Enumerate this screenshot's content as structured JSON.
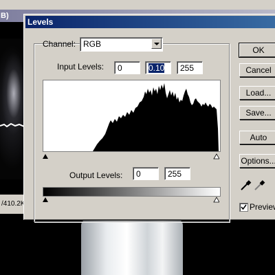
{
  "background": {
    "title_fragment": "B)",
    "status_text": "/410.2K"
  },
  "dialog": {
    "title": "Levels",
    "channel_label": "Channel:",
    "channel_value": "RGB",
    "input_levels_label": "Input Levels:",
    "input_black": "0",
    "input_gamma": "0.10",
    "input_white": "255",
    "output_levels_label": "Output Levels:",
    "output_black": "0",
    "output_white": "255",
    "buttons": {
      "ok": "OK",
      "cancel": "Cancel",
      "load": "Load...",
      "save": "Save...",
      "auto": "Auto",
      "options": "Options..."
    },
    "preview_label": "Preview",
    "preview_checked": true
  },
  "colors": {
    "titlebar_start": "#0a246a",
    "titlebar_end": "#3a6ea5",
    "dialog_face": "#d4d0c8"
  }
}
